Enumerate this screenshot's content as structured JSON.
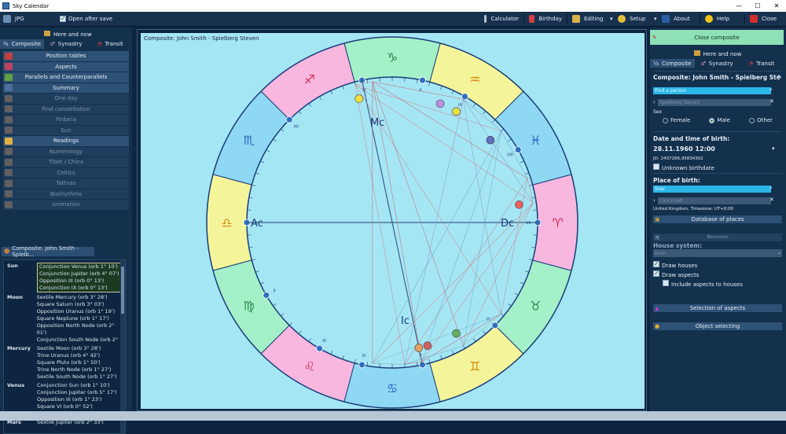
{
  "window": {
    "title": "Sky Calendar"
  },
  "toolbar": {
    "format": "JPG",
    "open_after_save": "Open after save",
    "calculator": "Calculator",
    "birthday": "Birthday",
    "editing": "Editing",
    "setup": "Setup",
    "about": "About",
    "help": "Help",
    "close": "Close"
  },
  "left": {
    "here_and_now": "Here and now",
    "tabs": [
      "Composite",
      "Synastry",
      "Transit"
    ],
    "menu": [
      {
        "label": "Position tables",
        "enabled": true
      },
      {
        "label": "Aspects",
        "enabled": true
      },
      {
        "label": "Parallels and Counterparallels",
        "enabled": true
      },
      {
        "label": "Summary",
        "enabled": true
      },
      {
        "label": "One day",
        "enabled": false
      },
      {
        "label": "Find constellation",
        "enabled": false
      },
      {
        "label": "Firdaria",
        "enabled": false
      },
      {
        "label": "Sun",
        "enabled": false
      },
      {
        "label": "Readings",
        "enabled": true
      },
      {
        "label": "Numerology",
        "enabled": false
      },
      {
        "label": "Tibet / China",
        "enabled": false
      },
      {
        "label": "Celtics",
        "enabled": false
      },
      {
        "label": "Tattvas",
        "enabled": false
      },
      {
        "label": "Biorhythms",
        "enabled": false
      },
      {
        "label": "Animation",
        "enabled": false
      }
    ],
    "section_label": "Composite: John Smith - Spielb...",
    "aspects": [
      {
        "planet": "Sun",
        "items": [
          "Conjunction Venus (orb 1° 10')",
          "Conjunction Jupiter (orb 4° 07')",
          "Opposition III (orb 0° 13')",
          "Conjunction IX (orb 0° 13')"
        ]
      },
      {
        "planet": "Moon",
        "items": [
          "Sextile Mercury (orb 3° 28')",
          "Square Saturn (orb 3° 03')",
          "Opposition Uranus (orb 1° 19')",
          "Square Neptune (orb 1° 17')",
          "Opposition North Node (orb 2° 01')",
          "Conjunction South Node (orb 2°"
        ]
      },
      {
        "planet": "Mercury",
        "items": [
          "Sextile Moon (orb 3° 28')",
          "Trine Uranus (orb 4° 42')",
          "Square Pluto (orb 1° 50')",
          "Trine North Node (orb 1° 27')",
          "Sextile South Node (orb 1° 27')"
        ]
      },
      {
        "planet": "Venus",
        "items": [
          "Conjunction Sun (orb 1° 10')",
          "Conjunction Jupiter (orb 5° 17')",
          "Opposition III (orb 1° 23')",
          "Square VI (orb 0° 52')",
          "Conjunction IX (orb 1° 23')"
        ]
      },
      {
        "planet": "Mars",
        "items": [
          "Sextile Jupiter (orb 2° 33')"
        ]
      }
    ]
  },
  "chart": {
    "title": "Composite: John Smith - Spielberg Steven",
    "ascendant": "Ac",
    "descendant": "Dc",
    "midheaven": "Mc",
    "imum_coeli": "Ic",
    "zodiac": [
      {
        "name": "Capricorn",
        "glyph": "♑",
        "color": "#a4f0c8"
      },
      {
        "name": "Sagittarius",
        "glyph": "♐",
        "color": "#f7b7de"
      },
      {
        "name": "Scorpio",
        "glyph": "♏",
        "color": "#8fd8f3"
      },
      {
        "name": "Libra",
        "glyph": "♎",
        "color": "#f4f49a"
      },
      {
        "name": "Virgo",
        "glyph": "♍",
        "color": "#a4f0c8"
      },
      {
        "name": "Leo",
        "glyph": "♌",
        "color": "#f7b7de"
      },
      {
        "name": "Cancer",
        "glyph": "♋",
        "color": "#8fd8f3"
      },
      {
        "name": "Gemini",
        "glyph": "♊",
        "color": "#f4f49a"
      },
      {
        "name": "Taurus",
        "glyph": "♉",
        "color": "#a4f0c8"
      },
      {
        "name": "Aries",
        "glyph": "♈",
        "color": "#f7b7de"
      },
      {
        "name": "Pisces",
        "glyph": "♓",
        "color": "#8fd8f3"
      },
      {
        "name": "Aquarius",
        "glyph": "♒",
        "color": "#f4f49a"
      }
    ],
    "houses": [
      "I",
      "II",
      "III",
      "IV",
      "V",
      "VI",
      "VII",
      "VIII",
      "IX",
      "X",
      "XI",
      "XII"
    ]
  },
  "right": {
    "close_composite": "Close composite",
    "here_and_now": "Here and now",
    "tabs": [
      "Composite",
      "Synastry",
      "Transit"
    ],
    "heading": "Composite: John Smith - Spielberg Ste",
    "find_person_placeholder": "Find a person",
    "name_value": "Spielberg Steven",
    "sex_label": "Sex",
    "sex_options": [
      "Female",
      "Male",
      "Other"
    ],
    "sex_selected": "Male",
    "dob_heading": "Date and time of birth:",
    "dob_value": "28.11.1960 12:00",
    "jd_value": "JD: 2437266,95834302",
    "unknown_birthdate": "Unknown birthdate",
    "place_heading": "Place of birth:",
    "place_value": "liver",
    "place_second": "Cincinnati",
    "place_info": "United Kingdom, Timezone: UT+0:00",
    "database_of_places": "Database of places",
    "persons": "Persons",
    "house_system_label": "House system:",
    "house_system_value": "Koch",
    "draw_houses": "Draw houses",
    "draw_aspects": "Draw aspects",
    "include_aspects_houses": "Include aspects to houses",
    "selection_of_aspects": "Selection of aspects",
    "object_selecting": "Object selecting"
  }
}
